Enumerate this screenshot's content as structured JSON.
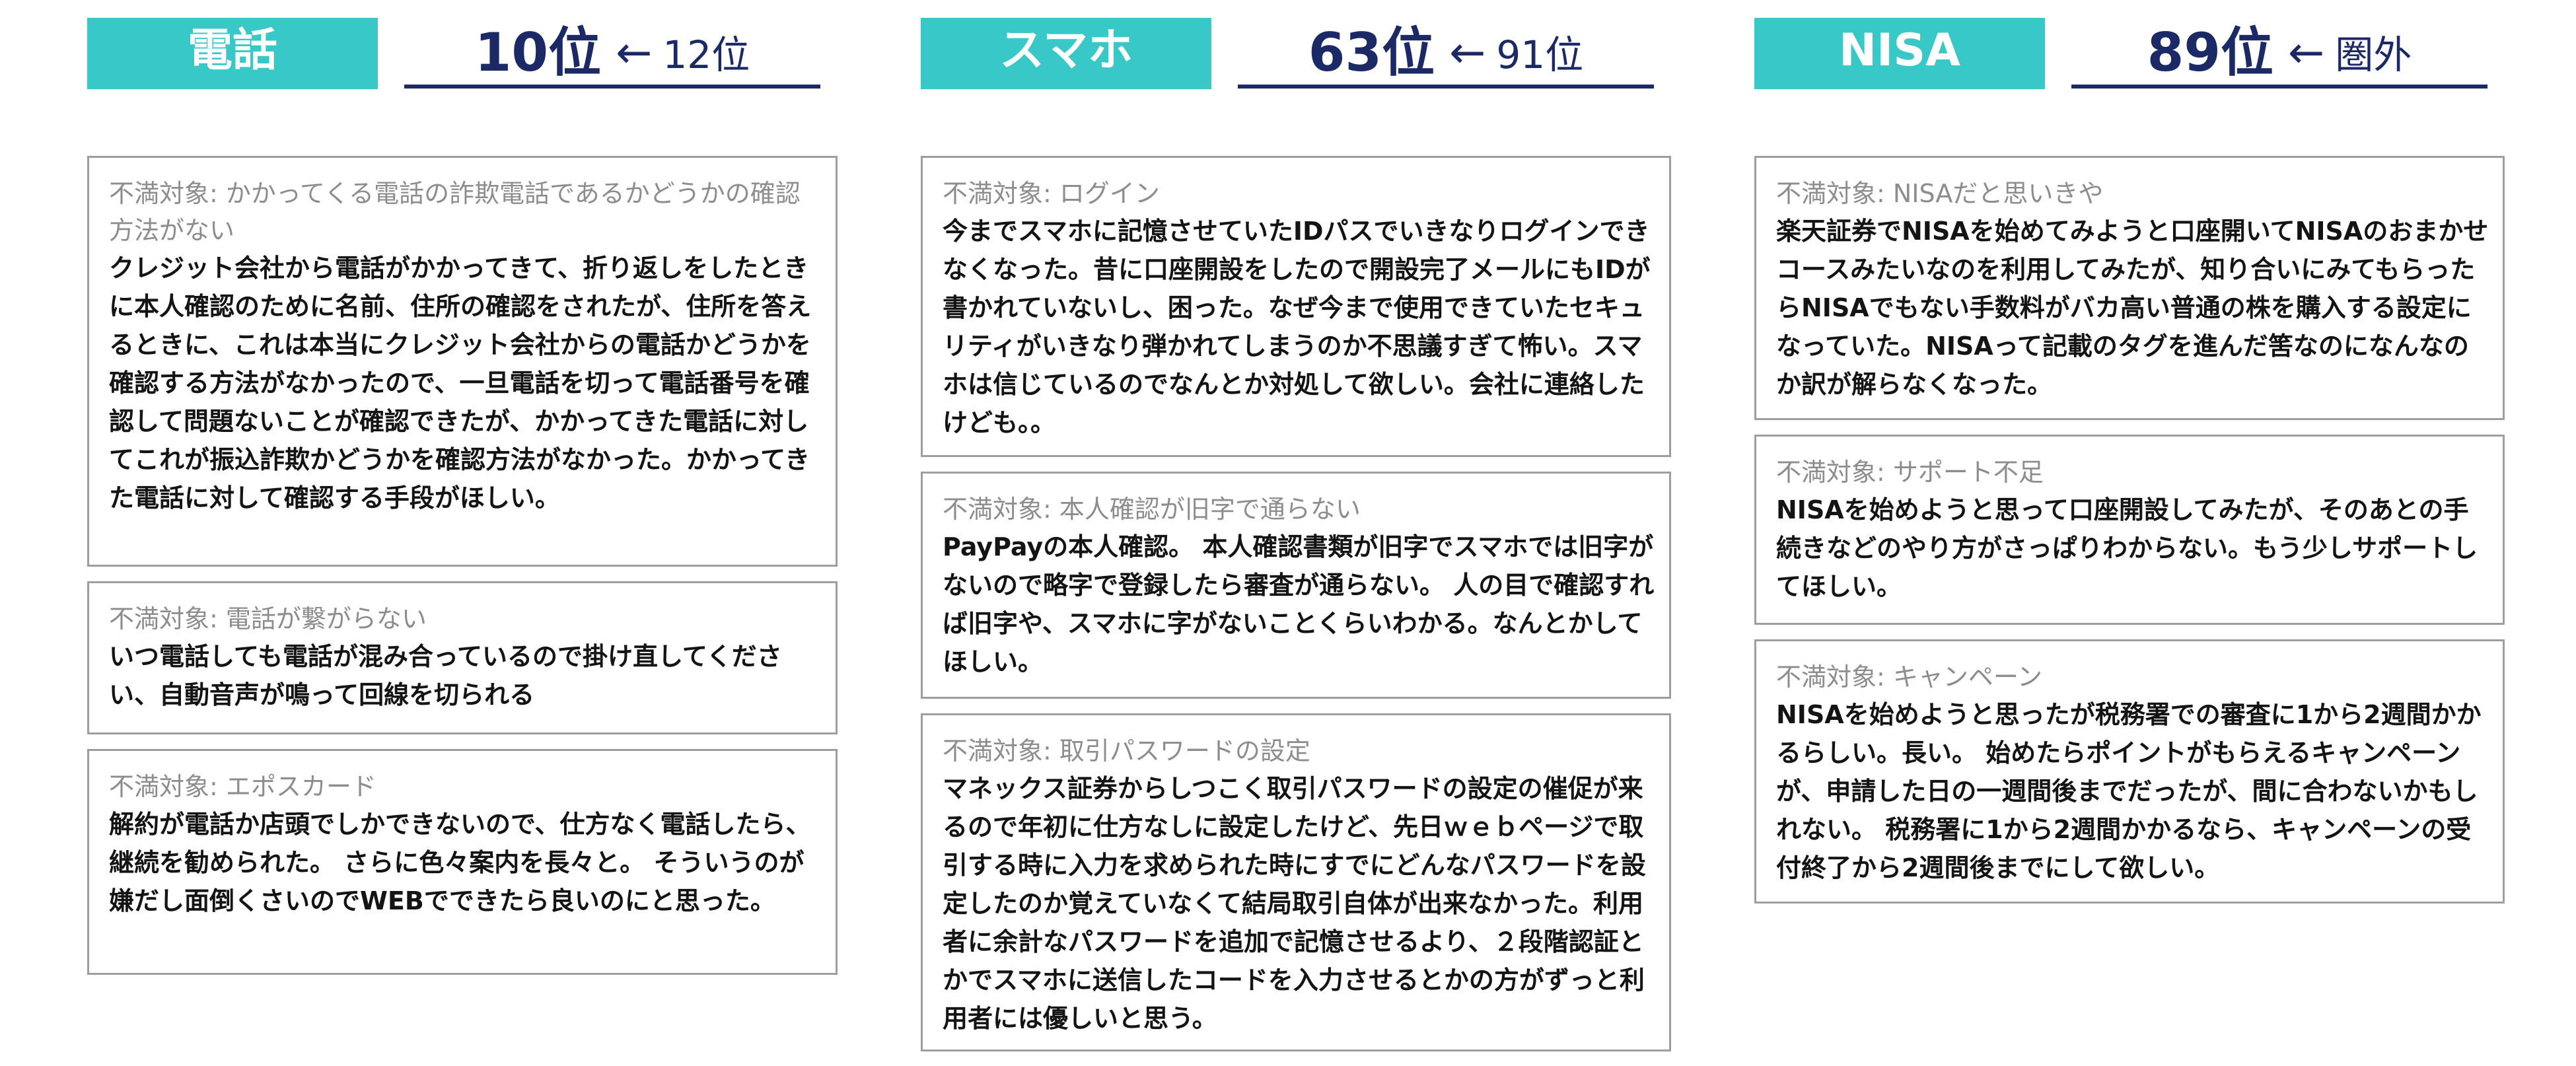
{
  "columns": [
    {
      "category": "電話",
      "rank_now": "10位",
      "arrow": "←",
      "rank_prev": "12位",
      "cards": [
        {
          "target": "不満対象: かかってくる電話の詐欺電話であるかどうかの確認方法がない",
          "body": "クレジット会社から電話がかかってきて、折り返しをしたときに本人確認のために名前、住所の確認をされたが、住所を答えるときに、これは本当にクレジット会社からの電話かどうかを確認する方法がなかったので、一旦電話を切って電話番号を確認して問題ないことが確認できたが、かかってきた電話に対してこれが振込詐欺かどうかを確認方法がなかった。かかってきた電話に対して確認する手段がほしい。"
        },
        {
          "target": "不満対象: 電話が繋がらない",
          "body": "いつ電話しても電話が混み合っているので掛け直してください、自動音声が鳴って回線を切られる"
        },
        {
          "target": "不満対象: エポスカード",
          "body": "解約が電話か店頭でしかできないので、仕方なく電話したら、継続を勧められた。 さらに色々案内を長々と。 そういうのが嫌だし面倒くさいのでWEBでできたら良いのにと思った。"
        }
      ]
    },
    {
      "category": "スマホ",
      "rank_now": "63位",
      "arrow": "←",
      "rank_prev": "91位",
      "cards": [
        {
          "target": "不満対象: ログイン",
          "body": "今までスマホに記憶させていたIDパスでいきなりログインできなくなった。昔に口座開設をしたので開設完了メールにもIDが書かれていないし、困った。なぜ今まで使用できていたセキュリティがいきなり弾かれてしまうのか不思議すぎて怖い。スマホは信じているのでなんとか対処して欲しい。会社に連絡したけども。。"
        },
        {
          "target": "不満対象: 本人確認が旧字で通らない",
          "body": "PayPayの本人確認。 本人確認書類が旧字でスマホでは旧字がないので略字で登録したら審査が通らない。 人の目で確認すれば旧字や、スマホに字がないことくらいわかる。なんとかしてほしい。"
        },
        {
          "target": "不満対象: 取引パスワードの設定",
          "body": "マネックス証券からしつこく取引パスワードの設定の催促が来るので年初に仕方なしに設定したけど、先日ｗｅｂページで取引する時に入力を求められた時にすでにどんなパスワードを設定したのか覚えていなくて結局取引自体が出来なかった。利用者に余計なパスワードを追加で記憶させるより、２段階認証とかでスマホに送信したコードを入力させるとかの方がずっと利用者には優しいと思う。"
        }
      ]
    },
    {
      "category": "NISA",
      "rank_now": "89位",
      "arrow": "←",
      "rank_prev": "圏外",
      "cards": [
        {
          "target": "不満対象: NISAだと思いきや",
          "body": "楽天証券でNISAを始めてみようと口座開いてNISAのおまかせコースみたいなのを利用してみたが、知り合いにみてもらったらNISAでもない手数料がバカ高い普通の株を購入する設定になっていた。NISAって記載のタグを進んだ筈なのになんなのか訳が解らなくなった。"
        },
        {
          "target": "不満対象: サポート不足",
          "body": "NISAを始めようと思って口座開設してみたが、そのあとの手続きなどのやり方がさっぱりわからない。もう少しサポートしてほしい。"
        },
        {
          "target": "不満対象: キャンペーン",
          "body": "NISAを始めようと思ったが税務署での審査に1から2週間かかるらしい。長い。 始めたらポイントがもらえるキャンペーンが、申請した日の一週間後までだったが、間に合わないかもしれない。 税務署に1から2週間かかるなら、キャンペーンの受付終了から2週間後までにして欲しい。"
        }
      ]
    }
  ]
}
